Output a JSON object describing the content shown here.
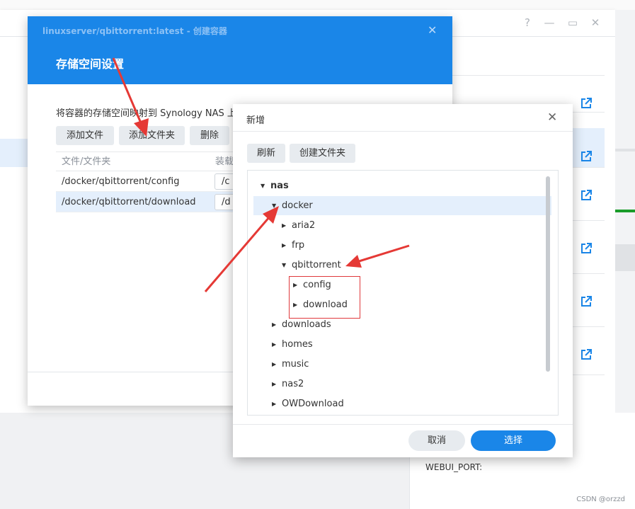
{
  "watermark": "CSDN @orzzd",
  "background": {
    "window_controls": [
      "?",
      "—",
      "▭",
      "✕"
    ],
    "webui_label": "WEBUI_PORT:"
  },
  "storage_dialog": {
    "subtitle": "linuxserver/qbittorrent:latest - 创建容器",
    "title": "存储空间设置",
    "description": "将容器的存储空间映射到 Synology NAS 上",
    "buttons": {
      "add_file": "添加文件",
      "add_folder": "添加文件夹",
      "delete": "删除"
    },
    "columns": {
      "path": "文件/文件夹",
      "mount": "装载"
    },
    "rows": [
      {
        "path": "/docker/qbittorrent/config",
        "mount": "/c"
      },
      {
        "path": "/docker/qbittorrent/download",
        "mount": "/d"
      }
    ]
  },
  "folder_dialog": {
    "title": "新增",
    "buttons": {
      "refresh": "刷新",
      "create_folder": "创建文件夹",
      "cancel": "取消",
      "select": "选择"
    },
    "tree": {
      "root": "nas",
      "docker": "docker",
      "aria2": "aria2",
      "frp": "frp",
      "qbittorrent": "qbittorrent",
      "config": "config",
      "download": "download",
      "downloads": "downloads",
      "homes": "homes",
      "music": "music",
      "nas2": "nas2",
      "owdownload": "OWDownload"
    }
  },
  "colors": {
    "accent": "#1a86e8",
    "highlight": "#e4effc",
    "annotation": "#e0393c"
  }
}
